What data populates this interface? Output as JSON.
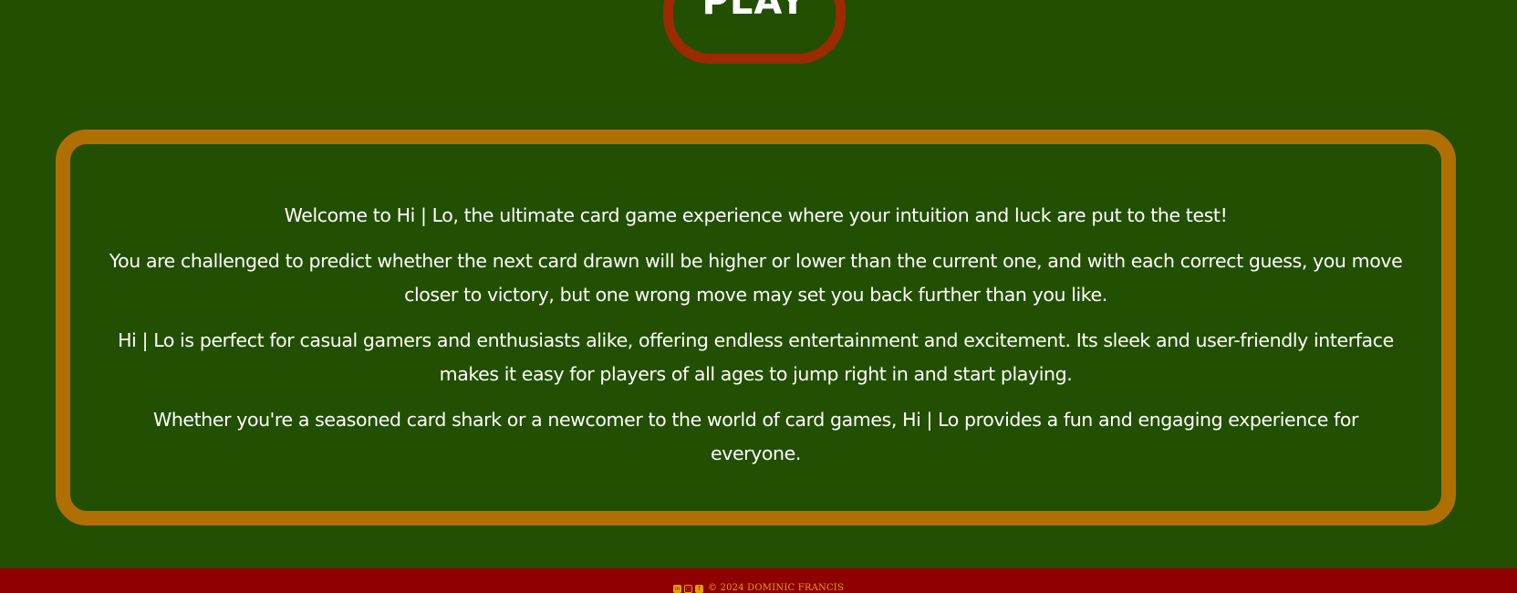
{
  "play_button": {
    "label": "PLAY"
  },
  "intro": {
    "paragraphs": [
      "Welcome to Hi | Lo, the ultimate card game experience where your intuition and luck are put to the test!",
      "You are challenged to predict whether the next card drawn will be higher or lower than the current one, and with each correct guess, you move closer to victory, but one wrong move may set you back further than you like.",
      "Hi | Lo is perfect for casual gamers and enthusiasts alike, offering endless entertainment and excitement. Its sleek and user-friendly interface makes it easy for players of all ages to jump right in and start playing.",
      "Whether you're a seasoned card shark or a newcomer to the world of card games, Hi | Lo provides a fun and engaging experience for everyone."
    ]
  },
  "footer": {
    "icons": [
      "linkedin-icon",
      "instagram-icon",
      "facebook-icon"
    ],
    "copyright": "© 2024 DOMINIC FRANCIS"
  },
  "colors": {
    "background": "#224f01",
    "play_border": "#9d2a00",
    "panel_border": "#b06f03",
    "footer_background": "#8f0000",
    "footer_text": "#e0a000"
  }
}
